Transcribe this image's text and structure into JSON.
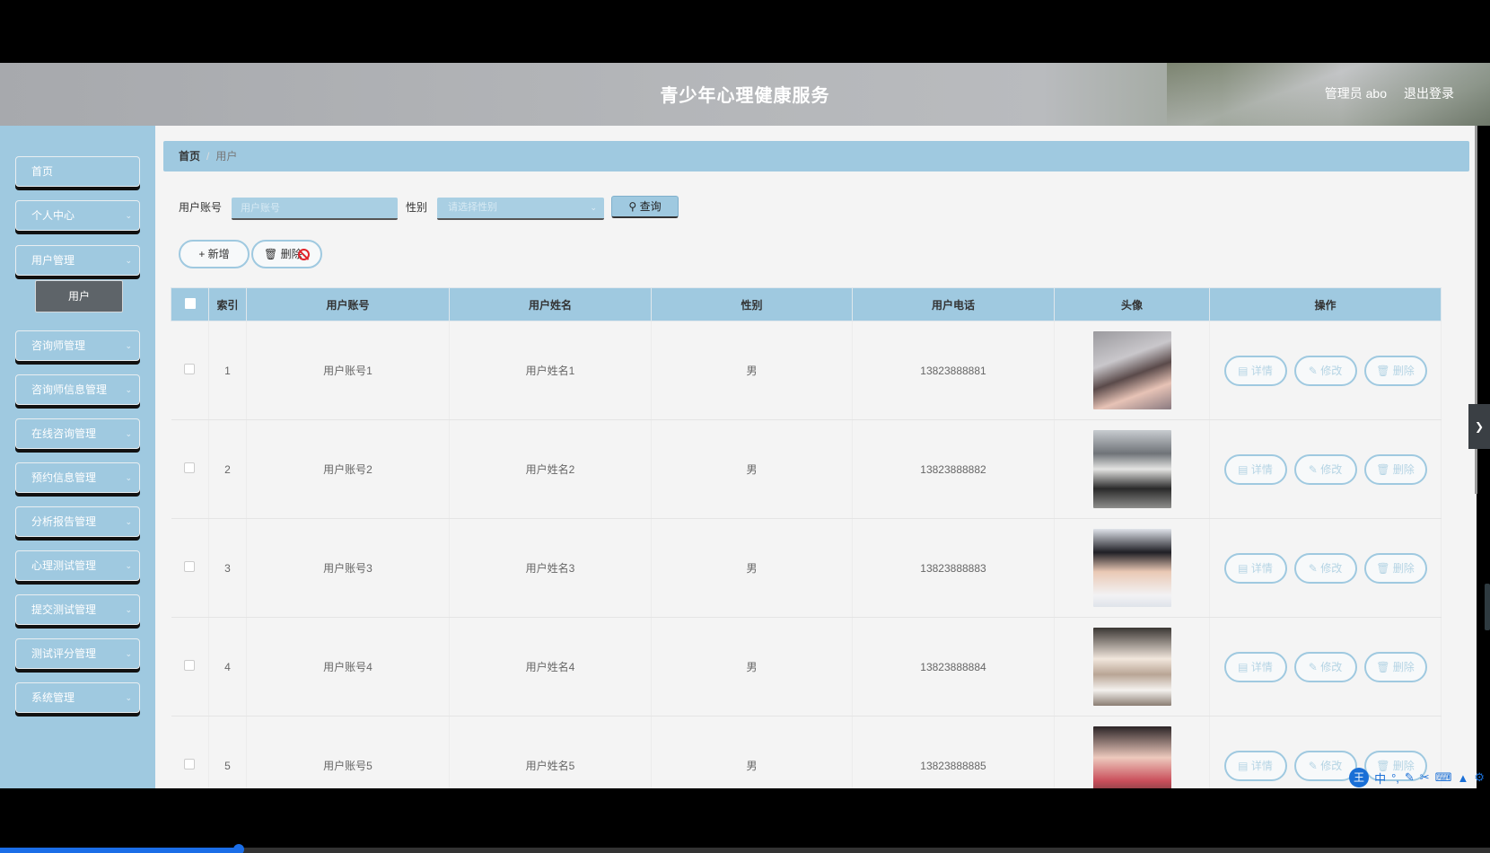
{
  "header": {
    "title": "青少年心理健康服务",
    "admin_label": "管理员 abo",
    "logout_label": "退出登录"
  },
  "sidebar": {
    "items": [
      {
        "label": "首页",
        "has_arrow": false
      },
      {
        "label": "个人中心",
        "has_arrow": true
      },
      {
        "label": "用户管理",
        "has_arrow": true
      },
      {
        "label": "咨询师管理",
        "has_arrow": true
      },
      {
        "label": "咨询师信息管理",
        "has_arrow": true
      },
      {
        "label": "在线咨询管理",
        "has_arrow": true
      },
      {
        "label": "预约信息管理",
        "has_arrow": true
      },
      {
        "label": "分析报告管理",
        "has_arrow": true
      },
      {
        "label": "心理测试管理",
        "has_arrow": true
      },
      {
        "label": "提交测试管理",
        "has_arrow": true
      },
      {
        "label": "测试评分管理",
        "has_arrow": true
      },
      {
        "label": "系统管理",
        "has_arrow": true
      }
    ],
    "active_sub": "用户"
  },
  "breadcrumb": {
    "home": "首页",
    "current": "用户"
  },
  "search": {
    "account_label": "用户账号",
    "account_placeholder": "用户账号",
    "gender_label": "性别",
    "gender_placeholder": "请选择性别",
    "query_label": "查询"
  },
  "actions": {
    "add_label": "新增",
    "delete_label": "删除"
  },
  "table": {
    "headers": [
      "索引",
      "用户账号",
      "用户姓名",
      "性别",
      "用户电话",
      "头像",
      "操作"
    ],
    "op_labels": {
      "detail": "详情",
      "edit": "修改",
      "delete": "删除"
    },
    "rows": [
      {
        "index": "1",
        "account": "用户账号1",
        "name": "用户姓名1",
        "gender": "男",
        "phone": "13823888881"
      },
      {
        "index": "2",
        "account": "用户账号2",
        "name": "用户姓名2",
        "gender": "男",
        "phone": "13823888882"
      },
      {
        "index": "3",
        "account": "用户账号3",
        "name": "用户姓名3",
        "gender": "男",
        "phone": "13823888883"
      },
      {
        "index": "4",
        "account": "用户账号4",
        "name": "用户姓名4",
        "gender": "男",
        "phone": "13823888884"
      },
      {
        "index": "5",
        "account": "用户账号5",
        "name": "用户姓名5",
        "gender": "男",
        "phone": "13823888885"
      }
    ]
  },
  "ime": {
    "logo": "王",
    "mode": "中"
  },
  "colors": {
    "accent": "#9fc9e0",
    "active_sub": "#5e6469"
  },
  "progress": {
    "fraction": 0.16
  }
}
